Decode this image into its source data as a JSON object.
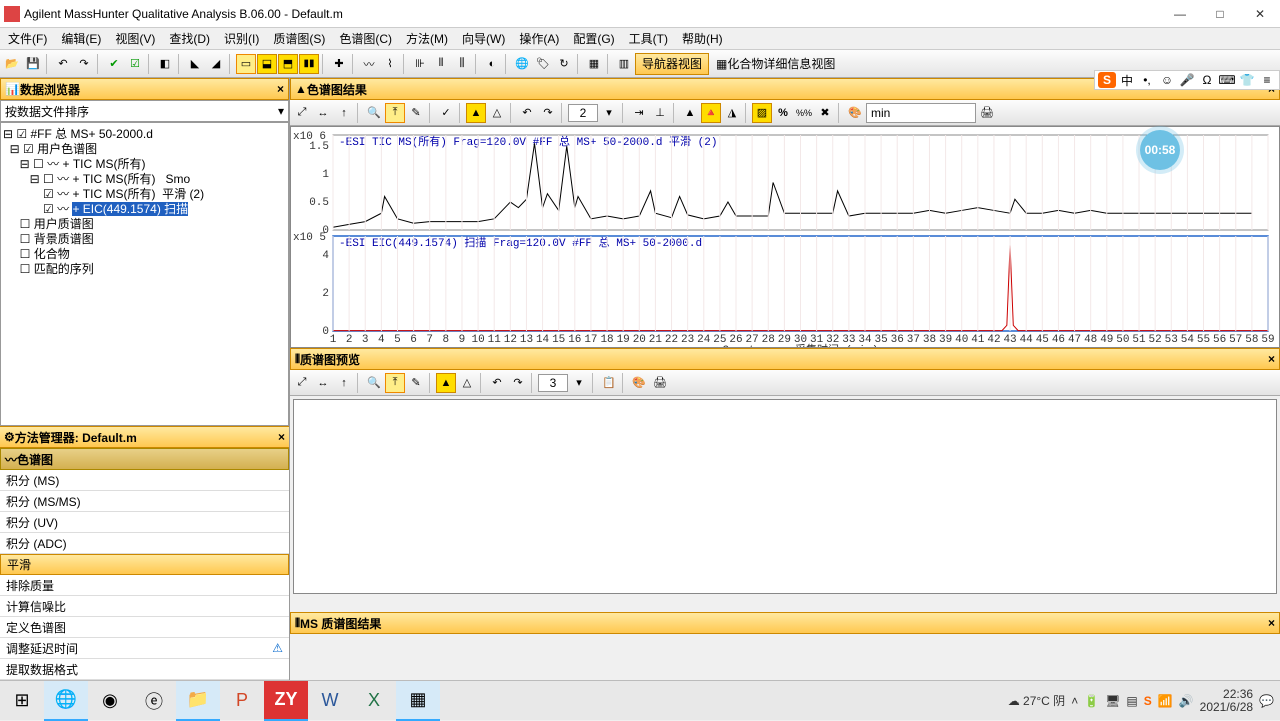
{
  "window": {
    "title": "Agilent MassHunter Qualitative Analysis B.06.00 - Default.m"
  },
  "menu": [
    "文件(F)",
    "编辑(E)",
    "视图(V)",
    "查找(D)",
    "识别(I)",
    "质谱图(S)",
    "色谱图(C)",
    "方法(M)",
    "向导(W)",
    "操作(A)",
    "配置(G)",
    "工具(T)",
    "帮助(H)"
  ],
  "navView": "导航器视图",
  "compoundView": "化合物详细信息视图",
  "leftPanel": {
    "title": "数据浏览器",
    "sortBy": "按数据文件排序",
    "tree": {
      "root": "#FF 总 MS+ 50-2000.d",
      "userChrom": "用户色谱图",
      "tic": "+ TIC MS(所有)",
      "ticSmo": "+ TIC MS(所有)   Smo",
      "ticSmooth2": "+ TIC MS(所有)  平滑 (2)",
      "eic": "+ EIC(449.1574) 扫描",
      "userMs": "用户质谱图",
      "bgMs": "背景质谱图",
      "compounds": "化合物",
      "matched": "匹配的序列"
    }
  },
  "methodPanel": {
    "title": "方法管理器: Default.m",
    "section": "色谱图",
    "items": [
      "积分 (MS)",
      "积分 (MS/MS)",
      "积分 (UV)",
      "积分 (ADC)",
      "平滑",
      "排除质量",
      "计算信噪比",
      "定义色谱图",
      "调整延迟时间",
      "提取数据格式"
    ],
    "selected": "平滑",
    "warning": "调整延迟时间"
  },
  "chromPanel": {
    "title": "色谱图结果",
    "spin": "2",
    "unit": "min",
    "plot1": {
      "yexp": "x10 6",
      "title": "-ESI TIC MS(所有) Frag=120.0V #FF 总 MS+ 50-2000.d   平滑 (2)",
      "yticks": [
        "0",
        "0.5",
        "1",
        "1.5"
      ]
    },
    "plot2": {
      "yexp": "x10 5",
      "title": "-ESI EIC(449.1574) 扫描 Frag=120.0V #FF 总 MS+ 50-2000.d",
      "yticks": [
        "0",
        "2",
        "4"
      ]
    },
    "xlabel": "Counts vs. 采集时间 (min)"
  },
  "msPreview": {
    "title": "质谱图预览",
    "spin": "3"
  },
  "msResult": {
    "title": "MS 质谱图结果"
  },
  "badge": "00:58",
  "weather": "27°C 阴",
  "clock": {
    "time": "22:36",
    "date": "2021/6/28"
  },
  "chart_data": [
    {
      "type": "line",
      "title": "-ESI TIC MS Frag=120.0V #FF 总 MS+ 50-2000.d 平滑(2)",
      "xlabel": "采集时间 (min)",
      "ylabel": "Counts x10^6",
      "xlim": [
        1,
        59
      ],
      "ylim": [
        0,
        1.7
      ],
      "x": [
        1,
        2,
        3,
        4,
        4.2,
        5,
        6,
        7,
        8,
        9,
        10,
        11,
        12,
        12.5,
        13,
        13.5,
        14,
        14.3,
        15,
        15.5,
        16,
        16.2,
        17,
        18,
        19,
        20,
        20.7,
        21,
        22,
        22.5,
        23,
        24,
        25,
        25.5,
        26,
        27,
        28,
        28.3,
        29,
        30,
        31,
        32,
        32.3,
        33,
        34,
        35,
        36,
        37,
        38,
        39,
        40,
        41,
        42,
        43,
        43.3,
        44,
        45,
        46,
        47,
        48,
        49,
        50,
        51,
        52,
        53,
        54,
        55,
        56,
        57,
        58,
        59
      ],
      "y": [
        0.05,
        0.1,
        0.15,
        0.3,
        0.6,
        0.2,
        0.12,
        0.15,
        0.15,
        0.15,
        0.15,
        0.2,
        0.5,
        0.4,
        0.55,
        1.55,
        0.4,
        0.65,
        0.35,
        1.5,
        0.4,
        0.6,
        0.2,
        0.25,
        0.2,
        0.25,
        0.7,
        0.3,
        0.22,
        0.6,
        0.27,
        0.2,
        0.25,
        0.5,
        0.25,
        0.25,
        0.25,
        0.85,
        0.3,
        0.3,
        0.3,
        0.3,
        0.7,
        0.25,
        0.3,
        0.3,
        0.3,
        0.3,
        0.35,
        0.3,
        0.35,
        0.4,
        0.35,
        0.3,
        0.55,
        0.3,
        0.3,
        0.35,
        0.3,
        0.35,
        0.3,
        0.3,
        0.3,
        0.3,
        0.3,
        0.3,
        0.3,
        0.3,
        0.3,
        0.3
      ]
    },
    {
      "type": "line",
      "title": "-ESI EIC(449.1574) 扫描 Frag=120.0V #FF 总 MS+ 50-2000.d",
      "xlabel": "采集时间 (min)",
      "ylabel": "Counts x10^5",
      "xlim": [
        1,
        59
      ],
      "ylim": [
        0,
        5
      ],
      "x": [
        1,
        42.5,
        42.8,
        43.0,
        43.2,
        43.5,
        59
      ],
      "y": [
        0.02,
        0.02,
        0.3,
        4.5,
        0.3,
        0.02,
        0.02
      ]
    }
  ]
}
